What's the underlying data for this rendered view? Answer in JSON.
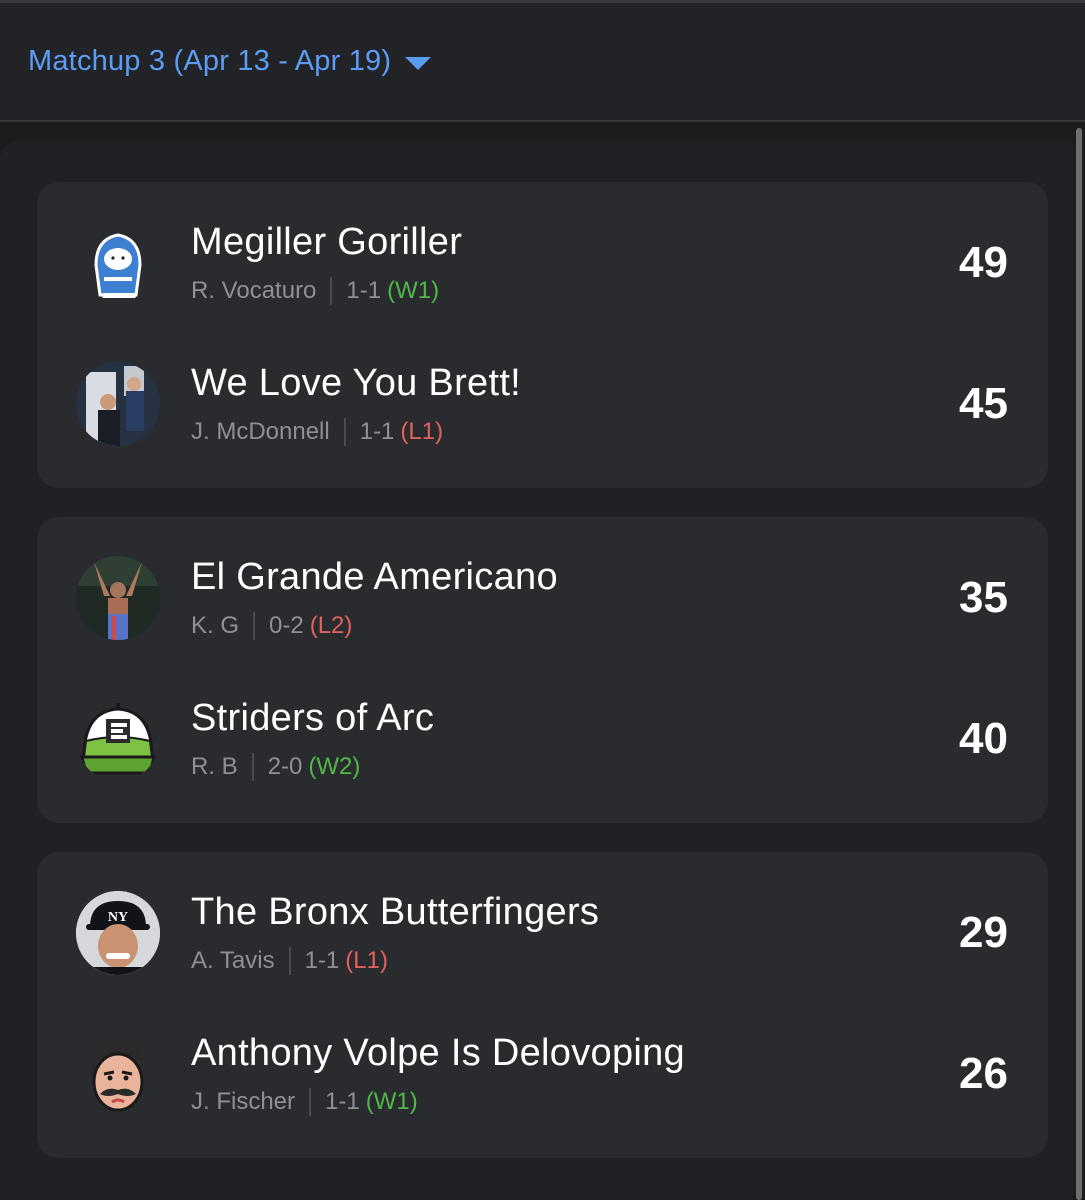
{
  "header": {
    "matchup_label": "Matchup 3 (Apr 13 - Apr 19)"
  },
  "matchups": [
    {
      "teams": [
        {
          "name": "Megiller Goriller",
          "owner": "R. Vocaturo",
          "record": "1-1",
          "streak": "(W1)",
          "streak_type": "win",
          "score": "49",
          "avatar_icon": "hooded-mascot-icon"
        },
        {
          "name": "We Love You Brett!",
          "owner": "J. McDonnell",
          "record": "1-1",
          "streak": "(L1)",
          "streak_type": "loss",
          "score": "45",
          "avatar_icon": "player-photo-avatar"
        }
      ]
    },
    {
      "teams": [
        {
          "name": "El Grande Americano",
          "owner": "K. G",
          "record": "0-2",
          "streak": "(L2)",
          "streak_type": "loss",
          "score": "35",
          "avatar_icon": "wrestler-photo-avatar"
        },
        {
          "name": "Striders of Arc",
          "owner": "R. B",
          "record": "2-0",
          "streak": "(W2)",
          "streak_type": "win",
          "score": "40",
          "avatar_icon": "green-cap-icon"
        }
      ]
    },
    {
      "teams": [
        {
          "name": "The Bronx Butterfingers",
          "owner": "A. Tavis",
          "record": "1-1",
          "streak": "(L1)",
          "streak_type": "loss",
          "score": "29",
          "avatar_icon": "yankees-player-avatar"
        },
        {
          "name": "Anthony Volpe Is Delovoping",
          "owner": "J. Fischer",
          "record": "1-1",
          "streak": "(W1)",
          "streak_type": "win",
          "score": "26",
          "avatar_icon": "mustache-face-icon"
        }
      ]
    }
  ],
  "colors": {
    "accent_blue": "#5b9cf5",
    "win_green": "#4fb848",
    "loss_red": "#e0615d",
    "card_bg": "#2a2b2e"
  }
}
